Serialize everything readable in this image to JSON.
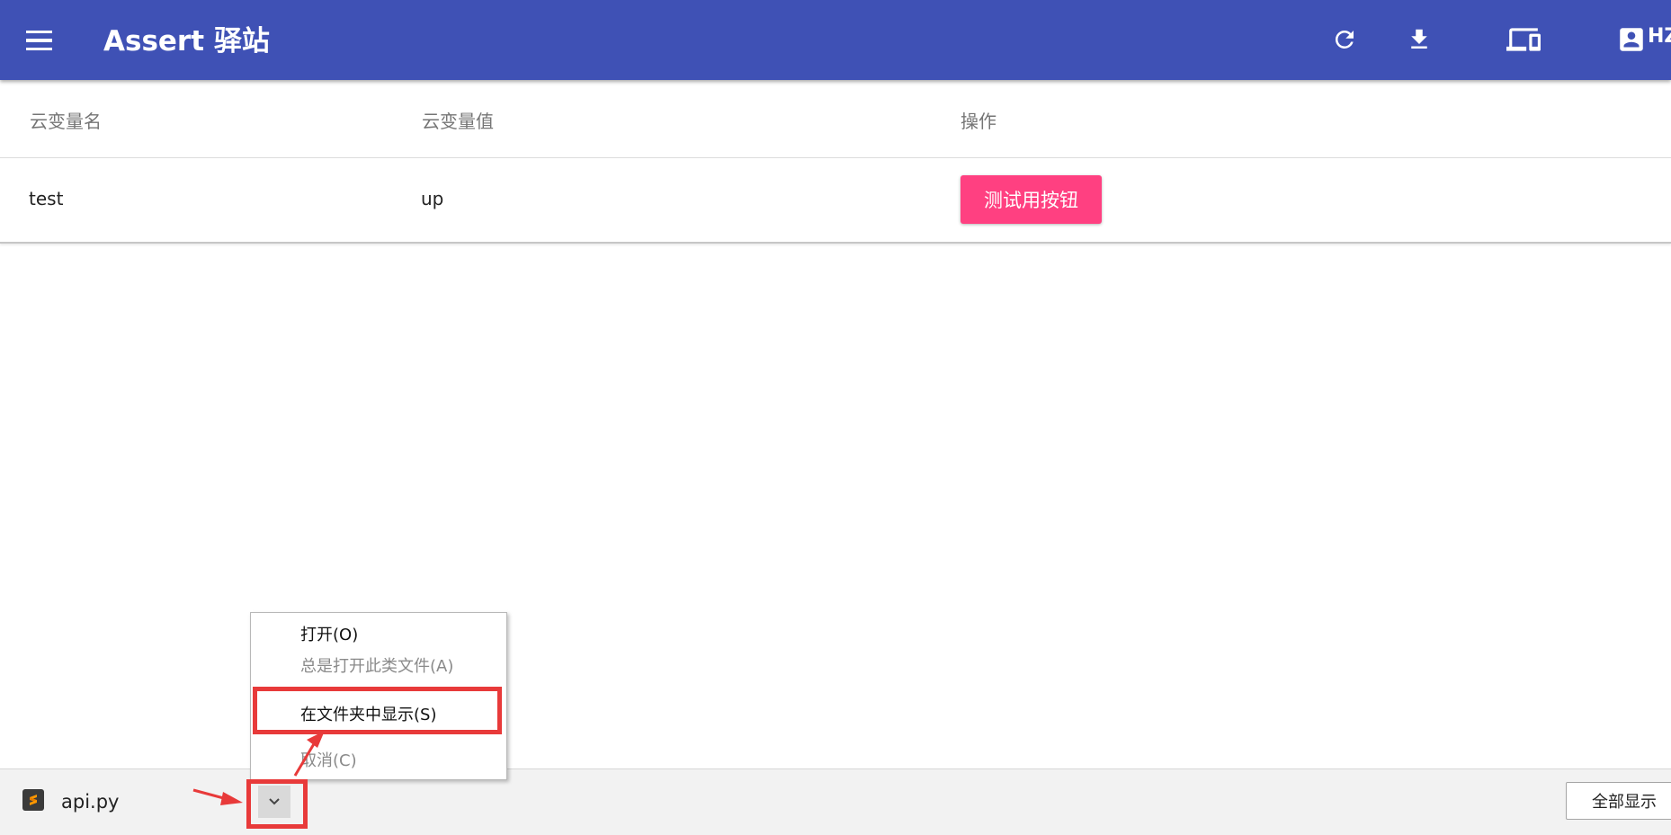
{
  "app": {
    "title": "Assert 驿站",
    "user_name": "HZ",
    "header_color": "#3f51b5"
  },
  "header_icons": [
    "menu-icon",
    "refresh-icon",
    "download-icon",
    "devices-icon",
    "account-box-icon"
  ],
  "table": {
    "columns": [
      "云变量名",
      "云变量值",
      "操作"
    ],
    "rows": [
      {
        "name": "test",
        "value": "up",
        "action_label": "测试用按钮"
      }
    ],
    "action_color": "#ff4081"
  },
  "context_menu": {
    "items": [
      {
        "label": "打开(O)",
        "disabled": false
      },
      {
        "label": "总是打开此类文件(A)",
        "disabled": true
      },
      {
        "label": "在文件夹中显示(S)",
        "disabled": false,
        "highlighted": true
      },
      {
        "label": "取消(C)",
        "disabled": true
      }
    ]
  },
  "download_bar": {
    "file_name": "api.py",
    "file_icon": "sublime-file-icon",
    "show_all_label": "全部显示"
  },
  "annotation_color": "#e83a3a"
}
